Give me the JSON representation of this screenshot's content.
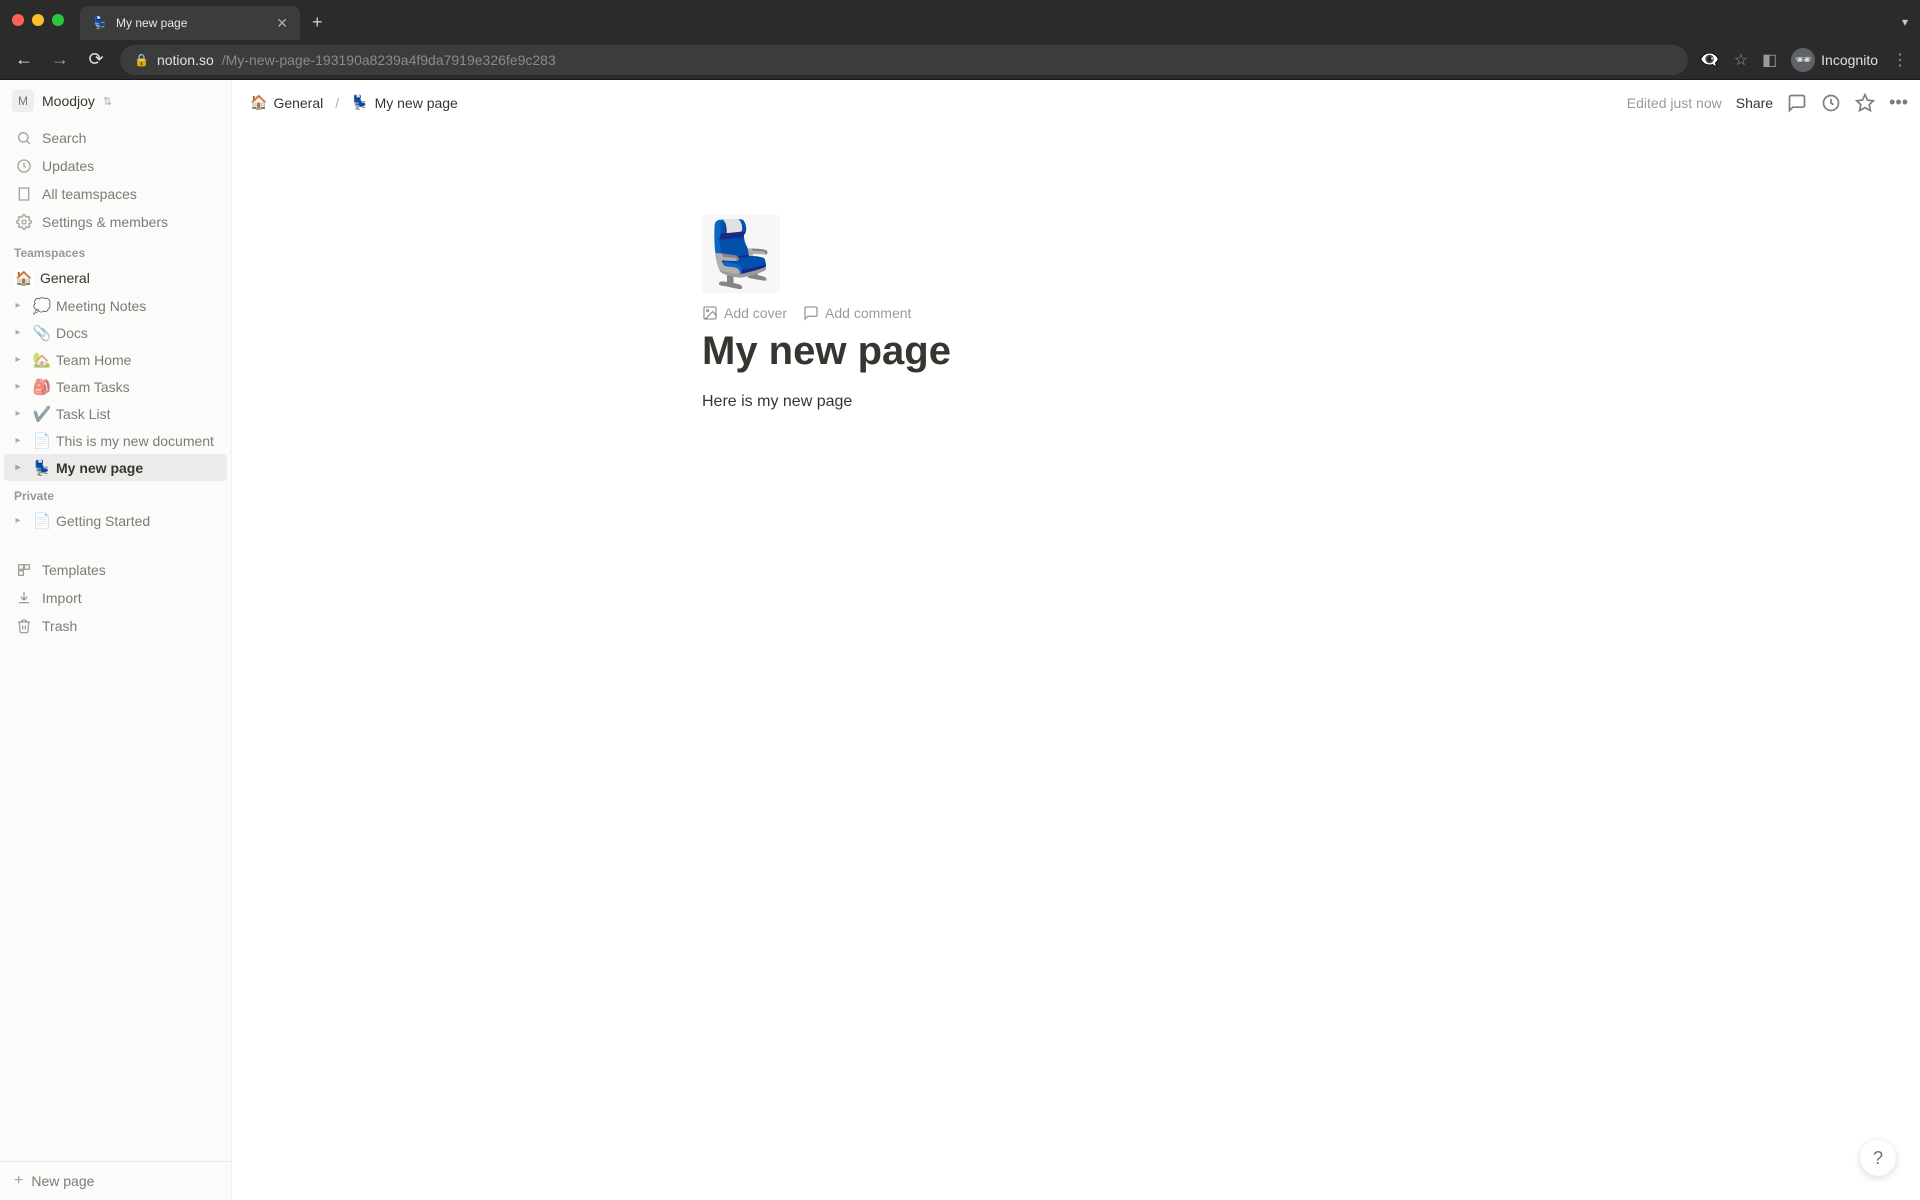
{
  "browser": {
    "tab_title": "My new page",
    "url_domain": "notion.so",
    "url_path": "/My-new-page-193190a8239a4f9da7919e326fe9c283",
    "incognito_label": "Incognito"
  },
  "workspace": {
    "avatar_letter": "M",
    "name": "Moodjoy"
  },
  "sidebar": {
    "top": [
      {
        "icon": "search",
        "label": "Search"
      },
      {
        "icon": "clock",
        "label": "Updates"
      },
      {
        "icon": "building",
        "label": "All teamspaces"
      },
      {
        "icon": "gear",
        "label": "Settings & members"
      }
    ],
    "teamspaces_header": "Teamspaces",
    "teamspace_name": "General",
    "teamspace_emoji": "🏠",
    "pages": [
      {
        "emoji": "💭",
        "label": "Meeting Notes",
        "active": false
      },
      {
        "emoji": "📎",
        "label": "Docs",
        "active": false
      },
      {
        "emoji": "🏡",
        "label": "Team Home",
        "active": false
      },
      {
        "emoji": "🎒",
        "label": "Team Tasks",
        "active": false
      },
      {
        "emoji": "✔️",
        "label": "Task List",
        "active": false
      },
      {
        "emoji": "📄",
        "label": "This is my new document",
        "active": false
      },
      {
        "emoji": "💺",
        "label": "My new page",
        "active": true
      }
    ],
    "private_header": "Private",
    "private_pages": [
      {
        "emoji": "📄",
        "label": "Getting Started"
      }
    ],
    "bottom": [
      {
        "icon": "templates",
        "label": "Templates"
      },
      {
        "icon": "import",
        "label": "Import"
      },
      {
        "icon": "trash",
        "label": "Trash"
      }
    ],
    "new_page_label": "New page"
  },
  "topbar": {
    "breadcrumb": [
      {
        "emoji": "🏠",
        "label": "General"
      },
      {
        "emoji": "💺",
        "label": "My new page"
      }
    ],
    "edited_text": "Edited just now",
    "share_label": "Share"
  },
  "page": {
    "icon_emoji": "💺",
    "add_cover_label": "Add cover",
    "add_comment_label": "Add comment",
    "title": "My new page",
    "body": "Here is my new page"
  },
  "help_label": "?"
}
